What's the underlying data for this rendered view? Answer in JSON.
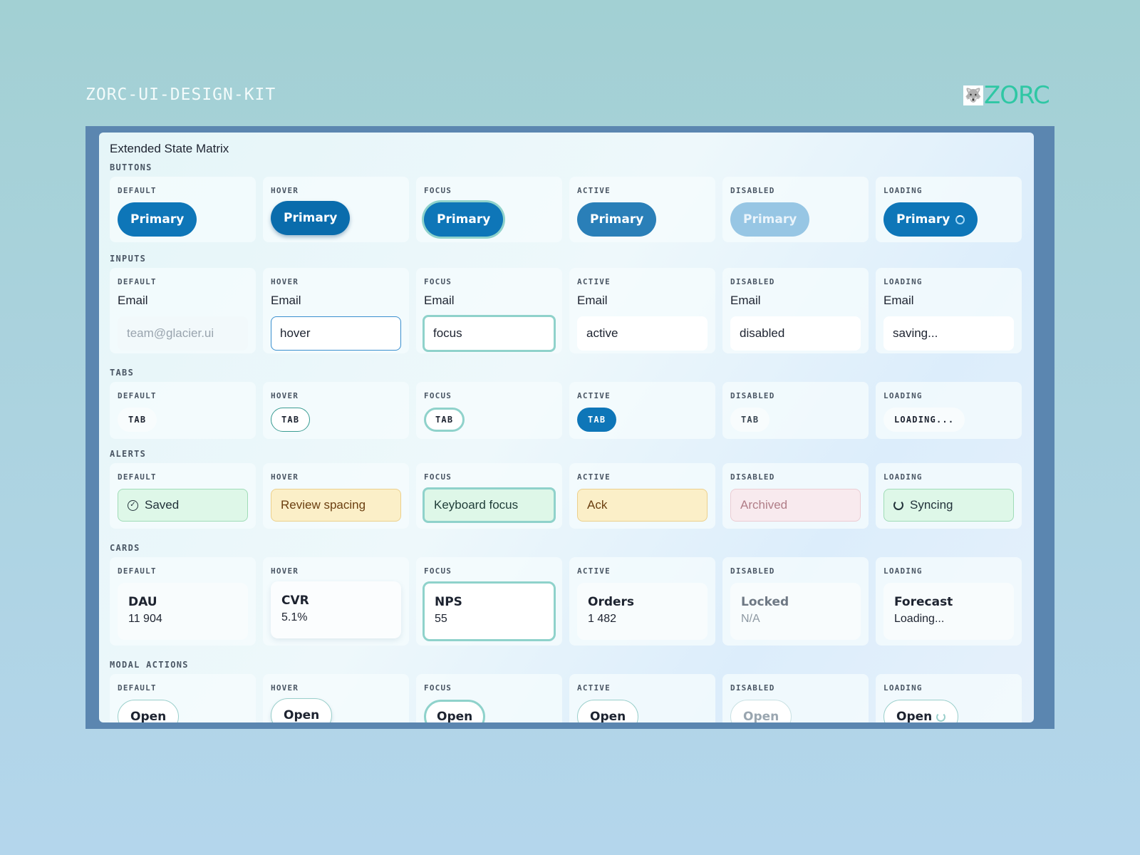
{
  "header": {
    "kit_title": "ZORC-UI-DESIGN-KIT",
    "brand_name": "ZORC",
    "brand_icon": "wolf-logo-icon"
  },
  "panel": {
    "title": "Extended State Matrix"
  },
  "states": [
    "DEFAULT",
    "HOVER",
    "FOCUS",
    "ACTIVE",
    "DISABLED",
    "LOADING"
  ],
  "buttons": {
    "label": "BUTTONS",
    "items": [
      "Primary",
      "Primary",
      "Primary",
      "Primary",
      "Primary",
      "Primary"
    ]
  },
  "inputs": {
    "label": "INPUTS",
    "field_label": "Email",
    "default_placeholder": "team@glacier.ui",
    "values": [
      "",
      "hover",
      "focus",
      "active",
      "disabled",
      "saving..."
    ]
  },
  "tabs": {
    "label": "TABS",
    "items": [
      "TAB",
      "TAB",
      "TAB",
      "TAB",
      "TAB",
      "LOADING..."
    ]
  },
  "alerts": {
    "label": "ALERTS",
    "items": [
      "Saved",
      "Review spacing",
      "Keyboard focus",
      "Ack",
      "Archived",
      "Syncing"
    ]
  },
  "cards": {
    "label": "CARDS",
    "items": [
      {
        "title": "DAU",
        "value": "11 904"
      },
      {
        "title": "CVR",
        "value": "5.1%"
      },
      {
        "title": "NPS",
        "value": "55"
      },
      {
        "title": "Orders",
        "value": "1 482"
      },
      {
        "title": "Locked",
        "value": "N/A"
      },
      {
        "title": "Forecast",
        "value": "Loading..."
      }
    ]
  },
  "modal_actions": {
    "label": "MODAL ACTIONS",
    "items": [
      "Open",
      "Open",
      "Open",
      "Open",
      "Open",
      "Open"
    ]
  },
  "colors": {
    "primary": "#0e76b8",
    "focus_ring": "#8fd2cb",
    "frame": "#5b86b0",
    "brand": "#2fc7a4",
    "success_bg": "#def7e8",
    "warning_bg": "#fbefc8",
    "muted_bg": "#f8eaee"
  }
}
